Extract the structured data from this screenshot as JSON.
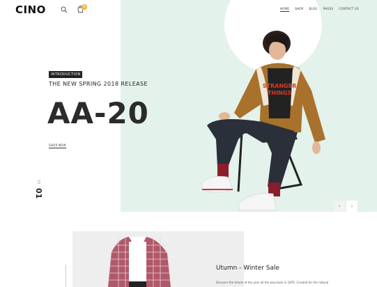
{
  "header": {
    "logo": "CINO",
    "cart_count": "0",
    "nav": [
      "HOME",
      "SHOP",
      "BLOG",
      "PAGES",
      "CONTACT US"
    ]
  },
  "hero": {
    "tag": "INTRODUCTION",
    "subtitle": "THE NEW SPRING 2018 RELEASE",
    "title": "AA-20",
    "shop_link": "SHOP NOW",
    "slide_current": "01",
    "slide_total": "03",
    "shirt_text_line1": "STRANGER",
    "shirt_text_line2": "THINGS",
    "prev_arrow": "‹",
    "next_arrow": "›"
  },
  "promo": {
    "title": "Utumn - Winter Sale",
    "text": "Discover the dream of the year all the way back in 1870. Created for the natural"
  },
  "colors": {
    "hero_bg": "#e3f2ea",
    "badge": "#f2b544"
  }
}
